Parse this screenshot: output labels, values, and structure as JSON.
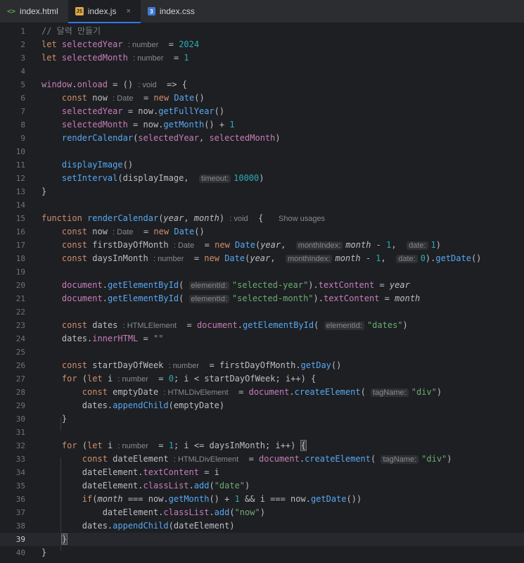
{
  "tabs": [
    {
      "label": "index.html",
      "icon": "html-file-icon",
      "active": false
    },
    {
      "label": "index.js",
      "icon": "js-file-icon",
      "active": true,
      "close": "×"
    },
    {
      "label": "index.css",
      "icon": "css-file-icon",
      "active": false
    }
  ],
  "editor": {
    "current_line": 39,
    "show_usages": "Show usages",
    "lines": [
      {
        "n": "1",
        "html": "<span class=\"cmt\">// 달력 만들기</span>"
      },
      {
        "n": "2",
        "html": "<span class=\"kw\">let</span> <span class=\"prop\">selectedYear</span> <span class=\"hint\">: number</span>  = <span class=\"num\">2024</span>"
      },
      {
        "n": "3",
        "html": "<span class=\"kw\">let</span> <span class=\"prop\">selectedMonth</span> <span class=\"hint\">: number</span>  = <span class=\"num\">1</span>"
      },
      {
        "n": "4",
        "html": ""
      },
      {
        "n": "5",
        "html": "<span class=\"prop\">window</span>.<span class=\"prop\">onload</span> = () <span class=\"hint\">: void</span>  => {"
      },
      {
        "n": "6",
        "html": "    <span class=\"kw\">const</span> now <span class=\"hint\">: Date</span>  = <span class=\"kw\">new</span> <span class=\"fn\">Date</span>()"
      },
      {
        "n": "7",
        "html": "    <span class=\"prop\">selectedYear</span> = now.<span class=\"fn\">getFullYear</span>()"
      },
      {
        "n": "8",
        "html": "    <span class=\"prop\">selectedMonth</span> = now.<span class=\"fn\">getMonth</span>() + <span class=\"num\">1</span>"
      },
      {
        "n": "9",
        "html": "    <span class=\"fn\">renderCalendar</span>(<span class=\"prop\">selectedYear</span>, <span class=\"prop\">selectedMonth</span>)"
      },
      {
        "n": "10",
        "html": ""
      },
      {
        "n": "11",
        "html": "    <span class=\"fn\">displayImage</span>()"
      },
      {
        "n": "12",
        "html": "    <span class=\"fn\">setInterval</span>(displayImage,  <span class=\"hint-box\">timeout:</span><span class=\"num\">10000</span>)"
      },
      {
        "n": "13",
        "html": "}"
      },
      {
        "n": "14",
        "html": ""
      },
      {
        "n": "15",
        "html": "<span class=\"kw\">function</span> <span class=\"fn\">renderCalendar</span>(<span class=\"param\">year</span>, <span class=\"param\">month</span>) <span class=\"hint\">: void</span>  {   <span class=\"usage\">Show usages</span>"
      },
      {
        "n": "16",
        "html": "    <span class=\"kw\">const</span> now <span class=\"hint\">: Date</span>  = <span class=\"kw\">new</span> <span class=\"fn\">Date</span>()"
      },
      {
        "n": "17",
        "html": "    <span class=\"kw\">const</span> firstDayOfMonth <span class=\"hint\">: Date</span>  = <span class=\"kw\">new</span> <span class=\"fn\">Date</span>(<span class=\"param\">year</span>,  <span class=\"hint-box\">monthIndex:</span><span class=\"param\">month</span> - <span class=\"num\">1</span>,  <span class=\"hint-box\">date:</span><span class=\"num\">1</span>)"
      },
      {
        "n": "18",
        "html": "    <span class=\"kw\">const</span> daysInMonth <span class=\"hint\">: number</span>  = <span class=\"kw\">new</span> <span class=\"fn\">Date</span>(<span class=\"param\">year</span>,  <span class=\"hint-box\">monthIndex:</span><span class=\"param\">month</span> - <span class=\"num\">1</span>,  <span class=\"hint-box\">date:</span><span class=\"num\">0</span>).<span class=\"fn\">getDate</span>()"
      },
      {
        "n": "19",
        "html": ""
      },
      {
        "n": "20",
        "html": "    <span class=\"prop\">document</span>.<span class=\"fn\">getElementById</span>( <span class=\"hint-box\">elementId:</span><span class=\"str\">\"selected-year\"</span>).<span class=\"prop\">textContent</span> = <span class=\"param\">year</span>"
      },
      {
        "n": "21",
        "html": "    <span class=\"prop\">document</span>.<span class=\"fn\">getElementById</span>( <span class=\"hint-box\">elementId:</span><span class=\"str\">\"selected-month\"</span>).<span class=\"prop\">textContent</span> = <span class=\"param\">month</span>"
      },
      {
        "n": "22",
        "html": ""
      },
      {
        "n": "23",
        "html": "    <span class=\"kw\">const</span> dates <span class=\"hint\">: HTMLElement</span>  = <span class=\"prop\">document</span>.<span class=\"fn\">getElementById</span>( <span class=\"hint-box\">elementId:</span><span class=\"str\">\"dates\"</span>)"
      },
      {
        "n": "24",
        "html": "    dates.<span class=\"prop\">innerHTML</span> = <span class=\"str\">\"\"</span>"
      },
      {
        "n": "25",
        "html": ""
      },
      {
        "n": "26",
        "html": "    <span class=\"kw\">const</span> startDayOfWeek <span class=\"hint\">: number</span>  = firstDayOfMonth.<span class=\"fn\">getDay</span>()"
      },
      {
        "n": "27",
        "html": "    <span class=\"kw\">for</span> (<span class=\"kw\">let</span> i <span class=\"hint\">: number</span>  = <span class=\"num\">0</span>; i &lt; startDayOfWeek; i++) {"
      },
      {
        "n": "28",
        "html": "        <span class=\"kw\">const</span> emptyDate <span class=\"hint\">: HTMLDivElement</span>  = <span class=\"prop\">document</span>.<span class=\"fn\">createElement</span>( <span class=\"hint-box\">tagName:</span><span class=\"str\">\"div\"</span>)"
      },
      {
        "n": "29",
        "html": "        dates.<span class=\"fn\">appendChild</span>(emptyDate)"
      },
      {
        "n": "30",
        "html": "    }"
      },
      {
        "n": "31",
        "html": ""
      },
      {
        "n": "32",
        "html": "    <span class=\"kw\">for</span> (<span class=\"kw\">let</span> i <span class=\"hint\">: number</span>  = <span class=\"num\">1</span>; i &lt;= daysInMonth; i++) <span class=\"bracket-hl\">{</span>"
      },
      {
        "n": "33",
        "html": "        <span class=\"kw\">const</span> dateElement <span class=\"hint\">: HTMLDivElement</span>  = <span class=\"prop\">document</span>.<span class=\"fn\">createElement</span>( <span class=\"hint-box\">tagName:</span><span class=\"str\">\"div\"</span>)"
      },
      {
        "n": "34",
        "html": "        dateElement.<span class=\"prop\">textContent</span> = i"
      },
      {
        "n": "35",
        "html": "        dateElement.<span class=\"prop\">classList</span>.<span class=\"fn\">add</span>(<span class=\"str\">\"date\"</span>)"
      },
      {
        "n": "36",
        "html": "        <span class=\"kw\">if</span>(<span class=\"param\">month</span> === now.<span class=\"fn\">getMonth</span>() + <span class=\"num\">1</span> &amp;&amp; i === now.<span class=\"fn\">getDate</span>())"
      },
      {
        "n": "37",
        "html": "            dateElement.<span class=\"prop\">classList</span>.<span class=\"fn\">add</span>(<span class=\"str\">\"now\"</span>)"
      },
      {
        "n": "38",
        "html": "        dates.<span class=\"fn\">appendChild</span>(dateElement)"
      },
      {
        "n": "39",
        "html": "    <span class=\"bracket-hl\">}</span>"
      },
      {
        "n": "40",
        "html": "}"
      }
    ]
  }
}
